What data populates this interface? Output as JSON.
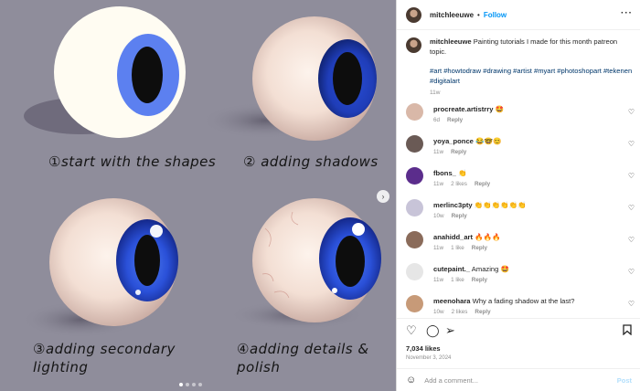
{
  "post": {
    "captions": [
      "①start with the shapes",
      "② adding shadows",
      "③adding secondary lighting",
      "④adding details & polish"
    ],
    "carousel": {
      "total": 4,
      "active": 1
    }
  },
  "header": {
    "username": "mitchleeuwe",
    "separator": "•",
    "follow_label": "Follow",
    "more_icon": "more-horizontal-icon"
  },
  "caption": {
    "username": "mitchleeuwe",
    "text": "Painting tutorials I made for this month patreon topic.",
    "hashtags": "#art #howtodraw #drawing #artist #myart #photoshopart #tekenen #digitalart",
    "time": "11w"
  },
  "comments": [
    {
      "username": "procreate.artistrry",
      "text": "🤩",
      "time": "6d",
      "likes": "",
      "reply": "Reply",
      "avatar_color": "#d9b8a8"
    },
    {
      "username": "yoya_ponce",
      "text": "😂🤓😊",
      "time": "11w",
      "likes": "",
      "reply": "Reply",
      "avatar_color": "#6a5a55"
    },
    {
      "username": "fbons_",
      "text": "👏",
      "time": "11w",
      "likes": "2 likes",
      "reply": "Reply",
      "avatar_color": "#5b2d8c"
    },
    {
      "username": "merlinc3pty",
      "text": "👏👏👏👏👏👏",
      "time": "10w",
      "likes": "",
      "reply": "Reply",
      "avatar_color": "#c8c4d8"
    },
    {
      "username": "anahidd_art",
      "text": "🔥🔥🔥",
      "time": "11w",
      "likes": "1 like",
      "reply": "Reply",
      "avatar_color": "#8a6b5a"
    },
    {
      "username": "cutepaint._",
      "text": "Amazing 🤩",
      "time": "11w",
      "likes": "1 like",
      "reply": "Reply",
      "avatar_color": "#e6e6e6"
    },
    {
      "username": "meenohara",
      "text": "Why a fading shadow at the last?",
      "time": "10w",
      "likes": "2 likes",
      "reply": "Reply",
      "avatar_color": "#c79a78"
    }
  ],
  "actions": {
    "likes": "7,034 likes",
    "date": "November 3, 2024",
    "add_comment_placeholder": "Add a comment...",
    "post_label": "Post"
  },
  "colors": {
    "canvas_bg": "#8f8d9b",
    "iris_blue": "#3b5fd8",
    "link_blue": "#0095f6",
    "hashtag_blue": "#00376b",
    "muted": "#8e8e8e"
  }
}
